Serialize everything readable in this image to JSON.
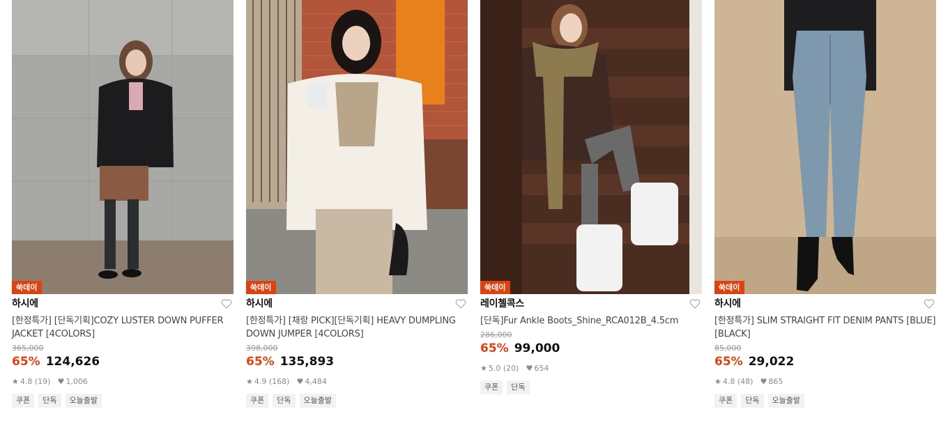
{
  "products": [
    {
      "badge": "쑥데이",
      "brand": "하시에",
      "title": "[한정특가] [단독기획]COZY LUSTER DOWN PUFFER JACKET [4COLORS]",
      "original_price": "365,000",
      "discount": "65%",
      "price": "124,626",
      "rating": "4.8",
      "reviews": "(19)",
      "likes": "1,006",
      "tags": [
        "쿠폰",
        "단독",
        "오늘출발"
      ]
    },
    {
      "badge": "쑥데이",
      "brand": "하시에",
      "title": "[한정특가] [채랑 PICK][단독기획] HEAVY DUMPLING DOWN JUMPER [4COLORS]",
      "original_price": "398,000",
      "discount": "65%",
      "price": "135,893",
      "rating": "4.9",
      "reviews": "(168)",
      "likes": "4,484",
      "tags": [
        "쿠폰",
        "단독",
        "오늘출발"
      ]
    },
    {
      "badge": "쑥데이",
      "brand": "레이첼콕스",
      "title": "[단독]Fur Ankle Boots_Shine_RCA012B_4.5cm",
      "original_price": "286,000",
      "discount": "65%",
      "price": "99,000",
      "rating": "5.0",
      "reviews": "(20)",
      "likes": "654",
      "tags": [
        "쿠폰",
        "단독"
      ]
    },
    {
      "badge": "쑥데이",
      "brand": "하시에",
      "title": "[한정특가] SLIM STRAIGHT FIT DENIM PANTS [BLUE][BLACK]",
      "original_price": "85,000",
      "discount": "65%",
      "price": "29,022",
      "rating": "4.8",
      "reviews": "(48)",
      "likes": "865",
      "tags": [
        "쿠폰",
        "단독",
        "오늘출발"
      ]
    }
  ],
  "icons": {
    "wishlist": "heart-outline-icon",
    "rating": "star-icon",
    "likes": "heart-filled-icon"
  },
  "colors": {
    "accent": "#e0420f",
    "muted": "#8a8a8a",
    "tag_bg": "#f2f2f2"
  }
}
